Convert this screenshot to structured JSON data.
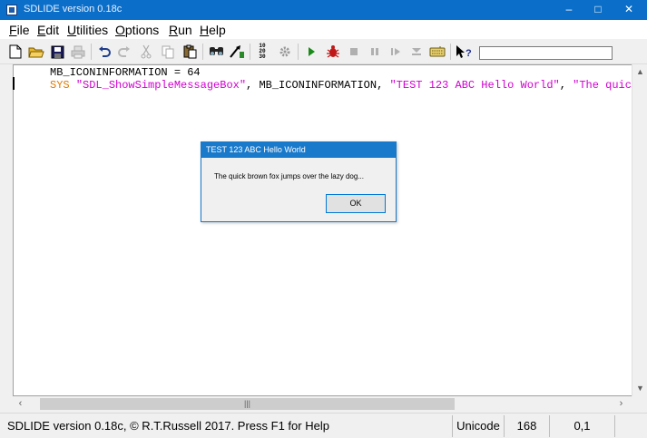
{
  "window": {
    "title": "SDLIDE version 0.18c",
    "controls": {
      "minimize": "–",
      "maximize": "□",
      "close": "✕"
    }
  },
  "menu": {
    "items": [
      {
        "accel": "F",
        "rest": "ile"
      },
      {
        "accel": "E",
        "rest": "dit"
      },
      {
        "accel": "U",
        "rest": "tilities"
      },
      {
        "accel": "O",
        "rest": "ptions"
      },
      {
        "accel": "R",
        "rest": "un"
      },
      {
        "accel": "H",
        "rest": "elp"
      }
    ]
  },
  "toolbar": {
    "icons": [
      "new-file-icon",
      "open-folder-icon",
      "save-icon",
      "print-icon",
      "undo-icon",
      "redo-icon",
      "cut-icon",
      "copy-icon",
      "paste-icon",
      "find-icon",
      "goto-icon",
      "renumber-icon",
      "settings-icon",
      "run-icon",
      "debug-icon",
      "stop-icon",
      "pause-icon",
      "step-icon",
      "step-over-icon",
      "keyboard-icon",
      "context-help-icon"
    ],
    "renumber_label": "10 20 30"
  },
  "editor": {
    "line1": "MB_ICONINFORMATION = 64",
    "line2": {
      "keyword": "SYS ",
      "string1": "\"SDL_ShowSimpleMessageBox\"",
      "mid": ", MB_ICONINFORMATION, ",
      "string2": "\"TEST 123 ABC Hello World\"",
      "sep": ", ",
      "string3": "\"The quick brow"
    }
  },
  "dialog": {
    "title": "TEST 123 ABC Hello World",
    "message": "The quick brown fox jumps over the lazy dog...",
    "ok_label": "OK"
  },
  "scrollbars": {
    "grip": "|||"
  },
  "statusbar": {
    "main": "SDLIDE version 0.18c, © R.T.Russell 2017.  Press F1 for Help",
    "encoding": "Unicode",
    "length": "168",
    "position": "0,1"
  },
  "colors": {
    "titlebar": "#0b6fc9",
    "keyword": "#e07a00",
    "string": "#d000d0",
    "dialog_accent": "#1979ca"
  }
}
